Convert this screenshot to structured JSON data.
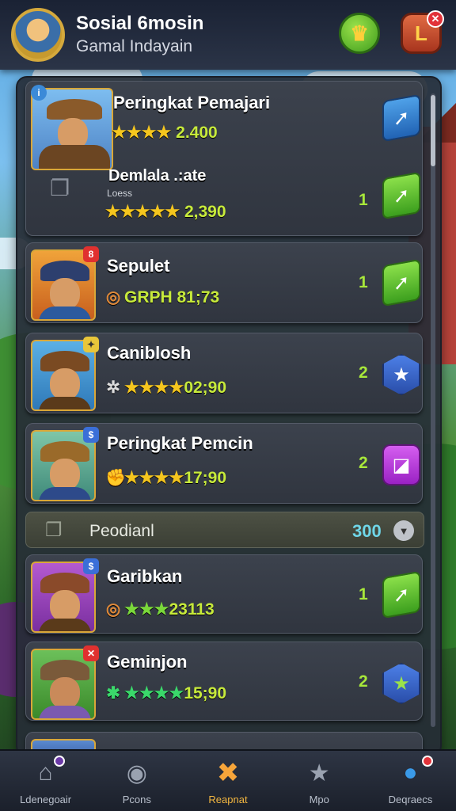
{
  "header": {
    "title": "Sosial 6mosin",
    "subtitle": "Gamal Indayain",
    "league_label": "L"
  },
  "rows": [
    {
      "name": "Peringkat Pemajari",
      "score": "2.400",
      "stars": "★★★★",
      "rank": "",
      "action": "green-arrow"
    },
    {
      "name": "Demlala .:ate",
      "sub": "Loess",
      "score": "2,390",
      "stars": "★★★★★",
      "rank": "1",
      "action": "green-arrow"
    },
    {
      "name": "Sepulet",
      "score": "GRPH 81;73",
      "lead": "◎",
      "rank": "1",
      "badge": "8",
      "action": "green-arrow"
    },
    {
      "name": "Caniblosh",
      "score": "02;90",
      "stars": "★★★★",
      "lead": "✲",
      "rank": "2",
      "action": "blue-star"
    },
    {
      "name": "Peringkat Pemcin",
      "score": "17;90",
      "stars": "★★★★",
      "lead": "✊",
      "rank": "2",
      "action": "purple-square"
    },
    {
      "name": "Garibkan",
      "score": "23113",
      "stars": "★★★",
      "lead": "◎",
      "rank": "1",
      "action": "green-arrow"
    },
    {
      "name": "Geminjon",
      "score": "15;90",
      "stars": "★★★★",
      "lead": "✱",
      "rank": "2",
      "action": "green-star"
    }
  ],
  "pending": {
    "label": "Peodianl",
    "value": "300"
  },
  "nav": [
    {
      "label": "Ldenegoair",
      "icon": "home-icon",
      "glyph": "⌂"
    },
    {
      "label": "Pcons",
      "icon": "camera-icon",
      "glyph": "◉"
    },
    {
      "label": "Reapnat",
      "icon": "crossed-swords-icon",
      "glyph": "✖"
    },
    {
      "label": "Mpo",
      "icon": "star-icon",
      "glyph": "★"
    },
    {
      "label": "Deqraecs",
      "icon": "globe-icon",
      "glyph": "●"
    }
  ],
  "colors": {
    "accent_gold": "#d9a738",
    "score_green": "#c7ea3b",
    "rank_green": "#a8e83a",
    "pending_cyan": "#6fd6e8"
  }
}
